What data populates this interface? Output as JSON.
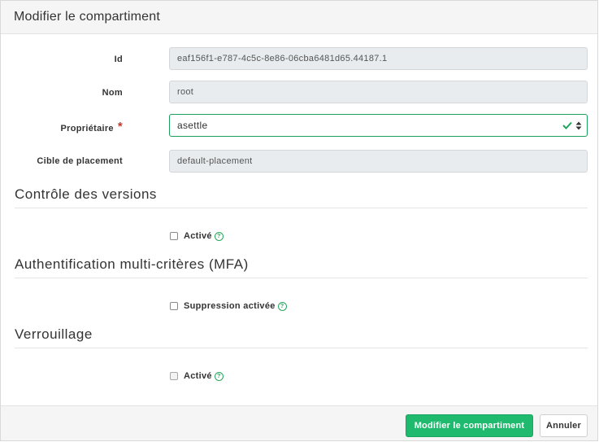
{
  "dialog": {
    "title": "Modifier le compartiment"
  },
  "form": {
    "id": {
      "label": "Id",
      "value": "eaf156f1-e787-4c5c-8e86-06cba6481d65.44187.1"
    },
    "name": {
      "label": "Nom",
      "value": "root"
    },
    "owner": {
      "label": "Propriétaire",
      "required_mark": "*",
      "value": "asettle",
      "check_icon": "check-icon",
      "sort_icon": "sort-caret-icon"
    },
    "placement": {
      "label": "Cible de placement",
      "value": "default-placement"
    }
  },
  "sections": {
    "versioning": {
      "title": "Contrôle des versions",
      "checkbox_label": "Activé",
      "checked": false
    },
    "mfa": {
      "title": "Authentification multi-critères (MFA)",
      "checkbox_label": "Suppression activée",
      "checked": false
    },
    "locking": {
      "title": "Verrouillage",
      "checkbox_label": "Activé",
      "checked": false
    }
  },
  "help_glyph": "?",
  "footer": {
    "submit_label": "Modifier le compartiment",
    "cancel_label": "Annuler"
  },
  "colors": {
    "accent": "#1fba6d",
    "valid_border": "#1e9e5b",
    "required": "#c0392b"
  }
}
